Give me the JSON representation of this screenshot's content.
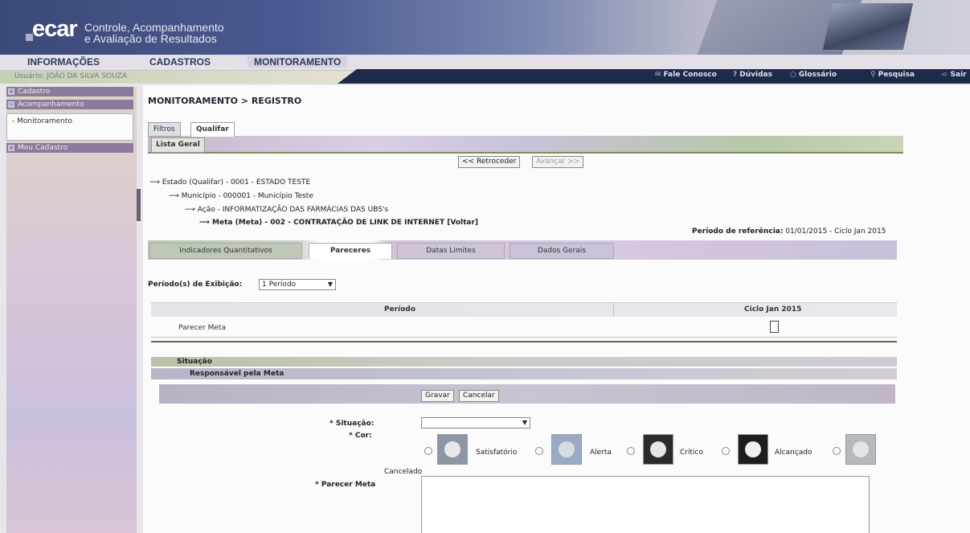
{
  "app": {
    "logo": "ecar",
    "subtitle_line1": "Controle, Acompanhamento",
    "subtitle_line2": "e Avaliação de Resultados"
  },
  "menu": {
    "items": [
      {
        "label": "INFORMAÇÕES"
      },
      {
        "label": "CADASTROS"
      },
      {
        "label": "MONITORAMENTO"
      }
    ]
  },
  "user": {
    "label": "Usuário: JOÃO DA SILVA SOUZA"
  },
  "toplinks": [
    {
      "label": "Fale Conosco",
      "icon": "mail-icon"
    },
    {
      "label": "Dúvidas",
      "icon": "help-icon"
    },
    {
      "label": "Glossário",
      "icon": "book-icon"
    },
    {
      "label": "Pesquisa",
      "icon": "search-icon"
    },
    {
      "label": "Sair",
      "icon": "exit-icon"
    }
  ],
  "sidebar": {
    "items": [
      {
        "label": "Cadastro"
      },
      {
        "label": "Acompanhamento"
      },
      {
        "label": "Meu Cadastro"
      }
    ],
    "sublink": "- Monitoramento"
  },
  "main": {
    "breadcrumb": "MONITORAMENTO > REGISTRO",
    "tabs": [
      {
        "label": "Filtros"
      },
      {
        "label": "Qualifar"
      }
    ],
    "lista_geral": "Lista Geral",
    "nav": {
      "prev": "<< Retroceder",
      "next": "Avançar >>"
    },
    "tree": [
      "Estado (Qualifar) - 0001 - ESTADO TESTE",
      "Município - 000001 - Município Teste",
      "Ação - INFORMATIZAÇÃO DAS FARMÁCIAS DAS UBS's",
      "Meta (Meta) - 002 - CONTRATAÇÃO DE LINK DE INTERNET",
      "[Voltar]"
    ],
    "periodo_ref_label": "Período de referência:",
    "periodo_ref_value": "01/01/2015 - Ciclo Jan 2015",
    "subtabs": [
      {
        "label": "Indicadores Quantitativos"
      },
      {
        "label": "Pareceres"
      },
      {
        "label": "Datas Limites"
      },
      {
        "label": "Dados Gerais"
      }
    ],
    "periodos_label": "Período(s) de Exibição:",
    "periodos_value": "1 Período",
    "grid": {
      "headers": [
        "Período",
        "Ciclo Jan 2015"
      ],
      "row_label": "Parecer Meta"
    },
    "situacao_bar": "Situação",
    "responsavel_bar": "Responsável pela Meta",
    "actions": {
      "save": "Gravar",
      "cancel": "Cancelar"
    },
    "form": {
      "situacao_label": "* Situação:",
      "situacao_value": "",
      "cor_label": "* Cor:",
      "cores": [
        {
          "label": "Satisfatório",
          "color": "#7f8a99"
        },
        {
          "label": "Alerta",
          "color": "#8ea0bc"
        },
        {
          "label": "Crítico",
          "color": "#2b2b2b"
        },
        {
          "label": "Alcançado",
          "color": "#1e1e1e"
        },
        {
          "label": "Cancelado",
          "color": "#b0b4bc"
        }
      ],
      "parecer_label": "* Parecer Meta"
    }
  }
}
